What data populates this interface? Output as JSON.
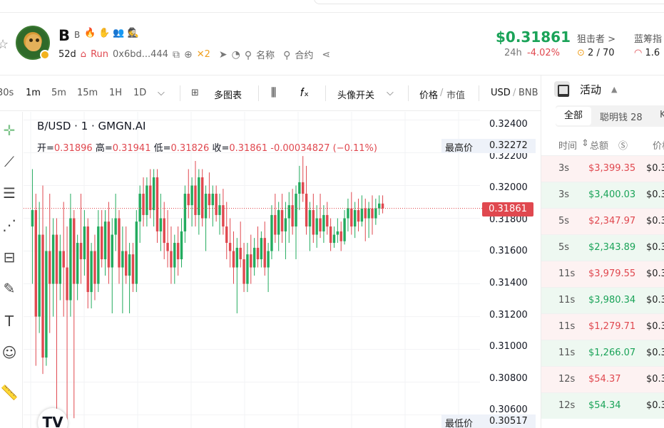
{
  "token": {
    "symbol": "B",
    "name": "B",
    "age": "52d",
    "run_label": "Run",
    "address": "0x6bd...444",
    "x_count": "2",
    "name_search": "名称",
    "contract_search": "合约"
  },
  "market": {
    "price": "$0.31861",
    "change_label": "24h",
    "change": "-4.02%",
    "sniper_label": "狙击者 >",
    "sniper_value": "2 / 70",
    "bundle_label": "蓝筹指",
    "bundle_value": "1.6"
  },
  "toolbar": {
    "intervals": [
      "30s",
      "1m",
      "5m",
      "15m",
      "1H",
      "1D"
    ],
    "active_interval": "1m",
    "multi_chart": "多图表",
    "avatar_toggle": "头像开关",
    "price_label": "价格",
    "mcap_label": "市值",
    "currency": "USD",
    "alt_currency": "BNB"
  },
  "chart": {
    "title": "B/USD · 1 · GMGN.AI",
    "ohlc": {
      "open_label": "开=",
      "open": "0.31896",
      "high_label": "高=",
      "high": "0.31941",
      "low_label": "低=",
      "low": "0.31826",
      "close_label": "收=",
      "close": "0.31861",
      "change": "-0.00034827 (−0.11%)"
    },
    "high_tag_label": "最高价",
    "high_tag_value": "0.32272",
    "low_tag_label": "最低价",
    "low_tag_value": "0.30517",
    "current_price": "0.31861",
    "y_ticks": [
      "0.32400",
      "0.32200",
      "0.32000",
      "0.31800",
      "0.31600",
      "0.31400",
      "0.31200",
      "0.31000",
      "0.30800",
      "0.30600"
    ],
    "tv_logo": "TV"
  },
  "chart_data": {
    "type": "candlestick",
    "title": "B/USD · 1 · GMGN.AI",
    "ylim": [
      0.3052,
      0.3245
    ],
    "series": [
      {
        "name": "B/USD",
        "ohlc": [
          [
            0.3175,
            0.321,
            0.314,
            0.3185
          ],
          [
            0.3185,
            0.3195,
            0.309,
            0.312
          ],
          [
            0.312,
            0.319,
            0.311,
            0.317
          ],
          [
            0.317,
            0.32,
            0.3085,
            0.3095
          ],
          [
            0.3095,
            0.3175,
            0.309,
            0.316
          ],
          [
            0.316,
            0.3195,
            0.311,
            0.314
          ],
          [
            0.314,
            0.318,
            0.312,
            0.317
          ],
          [
            0.317,
            0.318,
            0.306,
            0.314
          ],
          [
            0.314,
            0.317,
            0.313,
            0.316
          ],
          [
            0.316,
            0.319,
            0.312,
            0.315
          ],
          [
            0.315,
            0.3175,
            0.3055,
            0.313
          ],
          [
            0.313,
            0.3195,
            0.312,
            0.318
          ],
          [
            0.318,
            0.3185,
            0.3058,
            0.314
          ],
          [
            0.314,
            0.317,
            0.313,
            0.3165
          ],
          [
            0.3165,
            0.3195,
            0.314,
            0.3155
          ],
          [
            0.3155,
            0.3185,
            0.3145,
            0.3175
          ],
          [
            0.3175,
            0.318,
            0.3125,
            0.3135
          ],
          [
            0.3135,
            0.3165,
            0.3125,
            0.316
          ],
          [
            0.316,
            0.317,
            0.313,
            0.314
          ],
          [
            0.314,
            0.3185,
            0.3135,
            0.3175
          ],
          [
            0.3175,
            0.3185,
            0.315,
            0.3155
          ],
          [
            0.3155,
            0.3185,
            0.3145,
            0.3178
          ],
          [
            0.3178,
            0.319,
            0.314,
            0.315
          ],
          [
            0.315,
            0.318,
            0.3122,
            0.317
          ],
          [
            0.317,
            0.3195,
            0.316,
            0.318
          ],
          [
            0.318,
            0.3185,
            0.314,
            0.315
          ],
          [
            0.315,
            0.3175,
            0.3122,
            0.316
          ],
          [
            0.316,
            0.3175,
            0.314,
            0.3145
          ],
          [
            0.3145,
            0.3165,
            0.3122,
            0.3158
          ],
          [
            0.3158,
            0.3165,
            0.3135,
            0.314
          ],
          [
            0.314,
            0.3185,
            0.3135,
            0.3178
          ],
          [
            0.3178,
            0.32,
            0.3165,
            0.3195
          ],
          [
            0.3195,
            0.3205,
            0.3175,
            0.3182
          ],
          [
            0.3182,
            0.3205,
            0.3175,
            0.32
          ],
          [
            0.32,
            0.321,
            0.318,
            0.3185
          ],
          [
            0.3185,
            0.321,
            0.3175,
            0.3205
          ],
          [
            0.3205,
            0.321,
            0.3165,
            0.3172
          ],
          [
            0.3172,
            0.3195,
            0.316,
            0.318
          ],
          [
            0.318,
            0.319,
            0.3155,
            0.3165
          ],
          [
            0.3165,
            0.3185,
            0.315,
            0.316
          ],
          [
            0.316,
            0.3175,
            0.314,
            0.315
          ],
          [
            0.315,
            0.317,
            0.314,
            0.3165
          ],
          [
            0.3165,
            0.3175,
            0.3145,
            0.3155
          ],
          [
            0.3155,
            0.318,
            0.315,
            0.3172
          ],
          [
            0.3172,
            0.32,
            0.3165,
            0.3195
          ],
          [
            0.3195,
            0.321,
            0.318,
            0.3188
          ],
          [
            0.3188,
            0.3205,
            0.3175,
            0.32
          ],
          [
            0.32,
            0.3215,
            0.3175,
            0.3182
          ],
          [
            0.3182,
            0.321,
            0.317,
            0.3205
          ],
          [
            0.3205,
            0.321,
            0.3175,
            0.318
          ],
          [
            0.318,
            0.32,
            0.316,
            0.3195
          ],
          [
            0.3195,
            0.3208,
            0.318,
            0.3188
          ],
          [
            0.3188,
            0.32,
            0.3175,
            0.3195
          ],
          [
            0.3195,
            0.32,
            0.3178,
            0.3182
          ],
          [
            0.3182,
            0.3195,
            0.317,
            0.3188
          ],
          [
            0.3188,
            0.3198,
            0.317,
            0.3175
          ],
          [
            0.3175,
            0.319,
            0.3155,
            0.3165
          ],
          [
            0.3165,
            0.318,
            0.315,
            0.316
          ],
          [
            0.316,
            0.3172,
            0.314,
            0.315
          ],
          [
            0.315,
            0.3168,
            0.3122,
            0.3162
          ],
          [
            0.3162,
            0.3178,
            0.315,
            0.3155
          ],
          [
            0.3155,
            0.3165,
            0.3135,
            0.314
          ],
          [
            0.314,
            0.3165,
            0.3135,
            0.3158
          ],
          [
            0.3158,
            0.317,
            0.314,
            0.315
          ],
          [
            0.315,
            0.3168,
            0.3145,
            0.3162
          ],
          [
            0.3162,
            0.3175,
            0.315,
            0.3155
          ],
          [
            0.3155,
            0.3172,
            0.315,
            0.3168
          ],
          [
            0.3168,
            0.3178,
            0.3145,
            0.315
          ],
          [
            0.315,
            0.3165,
            0.3135,
            0.316
          ],
          [
            0.316,
            0.3188,
            0.3155,
            0.3182
          ],
          [
            0.3182,
            0.3195,
            0.3165,
            0.317
          ],
          [
            0.317,
            0.319,
            0.316,
            0.3185
          ],
          [
            0.3185,
            0.3195,
            0.3165,
            0.3172
          ],
          [
            0.3172,
            0.319,
            0.3155,
            0.318
          ],
          [
            0.318,
            0.3196,
            0.3165,
            0.3188
          ],
          [
            0.3188,
            0.3198,
            0.317,
            0.3175
          ],
          [
            0.3175,
            0.32,
            0.3155,
            0.3195
          ],
          [
            0.3195,
            0.3212,
            0.3185,
            0.3202
          ],
          [
            0.3202,
            0.3218,
            0.319,
            0.3195
          ],
          [
            0.3195,
            0.3212,
            0.317,
            0.3175
          ],
          [
            0.3175,
            0.319,
            0.316,
            0.3185
          ],
          [
            0.3185,
            0.3195,
            0.3165,
            0.317
          ],
          [
            0.317,
            0.3188,
            0.3162,
            0.318
          ],
          [
            0.318,
            0.3195,
            0.3168,
            0.3172
          ],
          [
            0.3172,
            0.3188,
            0.3165,
            0.3182
          ],
          [
            0.3182,
            0.319,
            0.317,
            0.3175
          ],
          [
            0.3175,
            0.318,
            0.316,
            0.3165
          ],
          [
            0.3165,
            0.3175,
            0.3162,
            0.317
          ],
          [
            0.317,
            0.318,
            0.3165,
            0.3172
          ],
          [
            0.3172,
            0.3178,
            0.316,
            0.3166
          ],
          [
            0.3166,
            0.3185,
            0.3164,
            0.318
          ],
          [
            0.318,
            0.3192,
            0.3172,
            0.3186
          ],
          [
            0.3186,
            0.3196,
            0.317,
            0.3175
          ],
          [
            0.3175,
            0.319,
            0.3168,
            0.3185
          ],
          [
            0.3185,
            0.3192,
            0.3172,
            0.3178
          ],
          [
            0.3178,
            0.3194,
            0.3175,
            0.3186
          ],
          [
            0.3186,
            0.3192,
            0.3166,
            0.318
          ],
          [
            0.318,
            0.319,
            0.3168,
            0.3186
          ],
          [
            0.3186,
            0.3194,
            0.317,
            0.318
          ],
          [
            0.318,
            0.3192,
            0.3176,
            0.3186
          ],
          [
            0.3186,
            0.3194,
            0.3182,
            0.3189
          ],
          [
            0.3189,
            0.3194,
            0.3183,
            0.3186
          ]
        ]
      }
    ]
  },
  "activity": {
    "title": "活动",
    "tabs": [
      "全部",
      "聪明钱 28",
      "K"
    ],
    "columns": {
      "time": "时间",
      "total": "总额",
      "price": "价格"
    },
    "rows": [
      {
        "side": "sell",
        "time": "3s",
        "amount": "$3,399.35",
        "price": "$0.3"
      },
      {
        "side": "buy",
        "time": "3s",
        "amount": "$3,400.03",
        "price": "$0.3"
      },
      {
        "side": "sell",
        "time": "5s",
        "amount": "$2,347.97",
        "price": "$0.3"
      },
      {
        "side": "buy",
        "time": "5s",
        "amount": "$2,343.89",
        "price": "$0.3"
      },
      {
        "side": "sell",
        "time": "11s",
        "amount": "$3,979.55",
        "price": "$0.3"
      },
      {
        "side": "buy",
        "time": "11s",
        "amount": "$3,980.34",
        "price": "$0.3"
      },
      {
        "side": "sell",
        "time": "11s",
        "amount": "$1,279.71",
        "price": "$0.3"
      },
      {
        "side": "buy",
        "time": "11s",
        "amount": "$1,266.07",
        "price": "$0.3"
      },
      {
        "side": "sell",
        "time": "12s",
        "amount": "$54.37",
        "price": "$0.3"
      },
      {
        "side": "buy",
        "time": "12s",
        "amount": "$54.34",
        "price": "$0.3"
      }
    ]
  },
  "colors": {
    "up": "#22ab5e",
    "down": "#e0484f"
  }
}
